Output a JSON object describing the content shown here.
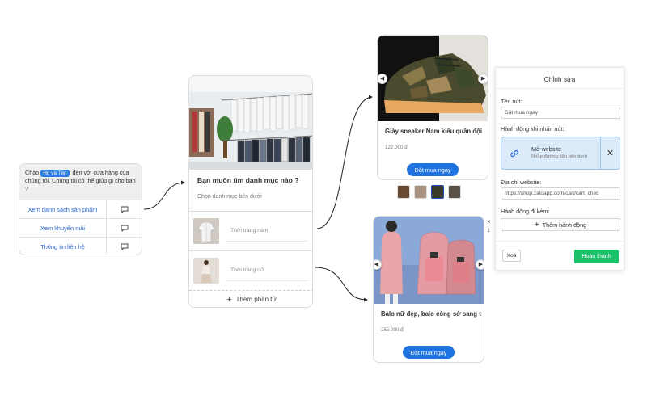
{
  "greeting": {
    "prefix": "Chào",
    "name_tag": "Họ và Tên",
    "text": ", đến với cửa hàng của chúng tôi. Chúng tôi có thể giúp gì cho bạn ?",
    "options": [
      "Xem danh sách sản phẩm",
      "Xem khuyến mãi",
      "Thông tin liên hệ"
    ]
  },
  "category": {
    "title": "Bạn muốn tìm danh mục nào ?",
    "subtitle": "Chọn danh mục bên dưới",
    "items": [
      "Thời trang nam",
      "Thời trang nữ"
    ],
    "add_label": "Thêm phần tử"
  },
  "products": [
    {
      "title": "Giày sneaker Nam kiểu quân đội",
      "price": "122.000 đ",
      "button": "Đặt mua ngay"
    },
    {
      "title": "Balo nữ đẹp, balo công sở sang t",
      "price": "255.000 đ",
      "button": "Đặt mua ngay"
    }
  ],
  "side_controls": {
    "close": "×",
    "resize": "↕"
  },
  "edit_panel": {
    "title": "Chỉnh sửa",
    "button_name_label": "Tên nút:",
    "button_name_value": "Đặt mua ngay",
    "action_label": "Hành động khi nhấn nút:",
    "action_title": "Mở website",
    "action_desc": "Nhập đường dẫn bên dưới",
    "url_label": "Địa chỉ website:",
    "url_value": "https://shop.zaloapp.com/cart/cart_chec",
    "extra_label": "Hành động đi kèm:",
    "add_action": "Thêm hành động",
    "delete": "Xoá",
    "done": "Hoàn thành"
  },
  "colors": {
    "accent": "#1f73e0",
    "link": "#2a67d6",
    "success": "#19c26a",
    "action_bg": "#dcebfa"
  }
}
